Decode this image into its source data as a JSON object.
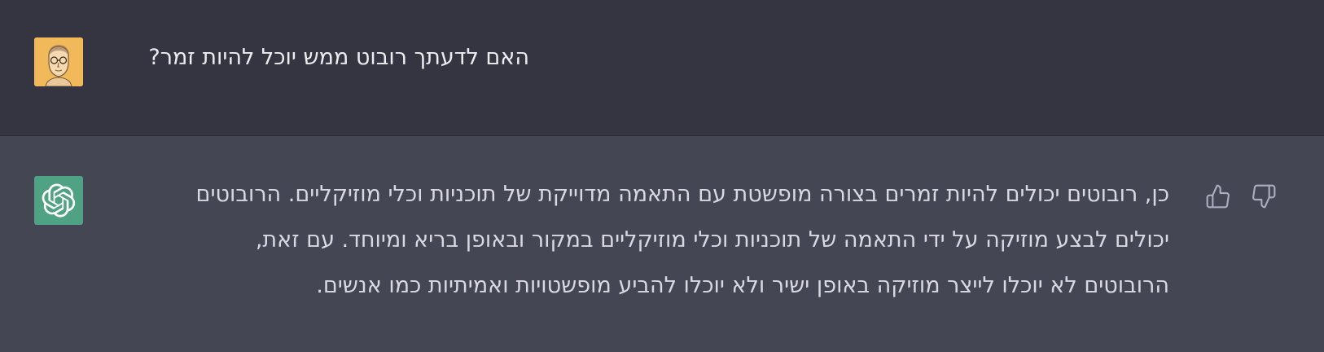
{
  "conversation": {
    "user_message": {
      "text": "האם לדעתך רובוט ממש יוכל להיות זמר?",
      "avatar_icon": "user-portrait-avatar"
    },
    "assistant_message": {
      "lines": [
        "כן, רובוטים יכולים להיות זמרים בצורה מופשטת עם התאמה מדוייקת של תוכניות וכלי מוזיקליים. הרובוטים",
        "יכולים לבצע מוזיקה על ידי התאמה של תוכניות וכלי מוזיקליים במקור ובאופן בריא ומיוחד. עם זאת,",
        "הרובוטים לא יוכלו לייצר מוזיקה באופן ישיר ולא יוכלו להביע מופשטויות ואמיתיות כמו אנשים."
      ],
      "avatar_icon": "openai-logo-icon"
    },
    "feedback": {
      "thumbs_up_icon": "thumbs-up-icon",
      "thumbs_down_icon": "thumbs-down-icon"
    }
  },
  "colors": {
    "user_bg": "#343541",
    "assistant_bg": "#444654",
    "bot_avatar_bg": "#4fa283",
    "user_avatar_bg": "#f2b95a",
    "text": "#ececf1"
  }
}
